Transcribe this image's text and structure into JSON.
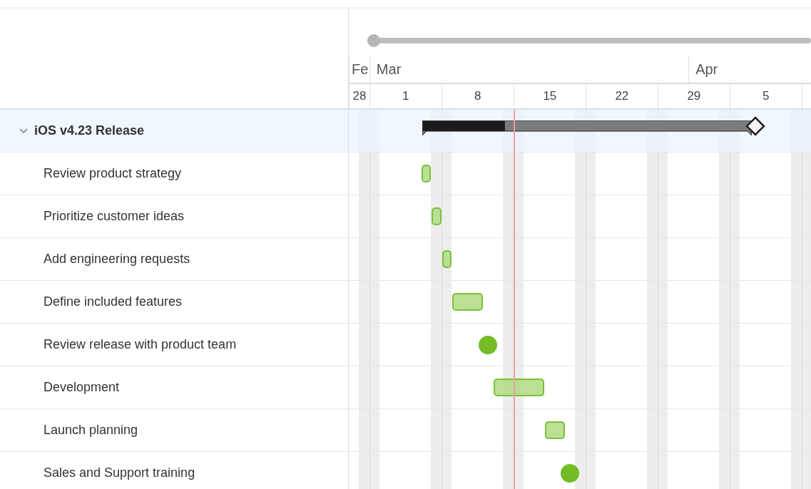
{
  "zoom_slider": {
    "level": 0
  },
  "timeline": {
    "months": [
      {
        "label": "Fe"
      },
      {
        "label": "Mar"
      },
      {
        "label": "Apr"
      }
    ],
    "weeks": [
      {
        "label": "28"
      },
      {
        "label": "1"
      },
      {
        "label": "8"
      },
      {
        "label": "15"
      },
      {
        "label": "22"
      },
      {
        "label": "29"
      },
      {
        "label": "5"
      }
    ]
  },
  "groups": [
    {
      "name": "iOS v4.23 Release",
      "expanded": true,
      "level": 0.25,
      "children": [
        {
          "kind": "task",
          "name": "Review product strategy"
        },
        {
          "kind": "task",
          "name": "Prioritize customer ideas"
        },
        {
          "kind": "task",
          "name": "Add engineering requests"
        },
        {
          "kind": "task",
          "name": "Define included features"
        },
        {
          "kind": "milestone",
          "name": "Review release with product team"
        },
        {
          "kind": "task",
          "name": "Development"
        },
        {
          "kind": "task",
          "name": "Launch planning"
        },
        {
          "kind": "milestone",
          "name": "Sales and Support training"
        }
      ]
    }
  ]
}
